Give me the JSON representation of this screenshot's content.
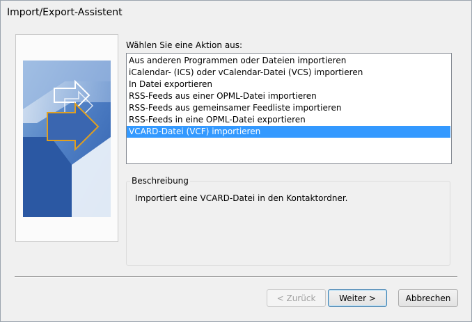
{
  "window": {
    "title": "Import/Export-Assistent"
  },
  "prompt": "Wählen Sie eine Aktion aus:",
  "actions": [
    {
      "label": "Aus anderen Programmen oder Dateien importieren",
      "selected": false
    },
    {
      "label": "iCalendar- (ICS) oder vCalendar-Datei (VCS) importieren",
      "selected": false
    },
    {
      "label": "In Datei exportieren",
      "selected": false
    },
    {
      "label": "RSS-Feeds aus einer OPML-Datei importieren",
      "selected": false
    },
    {
      "label": "RSS-Feeds aus gemeinsamer Feedliste importieren",
      "selected": false
    },
    {
      "label": "RSS-Feeds in eine OPML-Datei exportieren",
      "selected": false
    },
    {
      "label": "VCARD-Datei (VCF) importieren",
      "selected": true
    }
  ],
  "description": {
    "legend": "Beschreibung",
    "text": "Importiert eine VCARD-Datei in den Kontaktordner."
  },
  "buttons": {
    "back": "< Zurück",
    "next": "Weiter >",
    "cancel": "Abbrechen"
  },
  "colors": {
    "selection": "#3399ff",
    "window_bg": "#f0f0f0"
  }
}
